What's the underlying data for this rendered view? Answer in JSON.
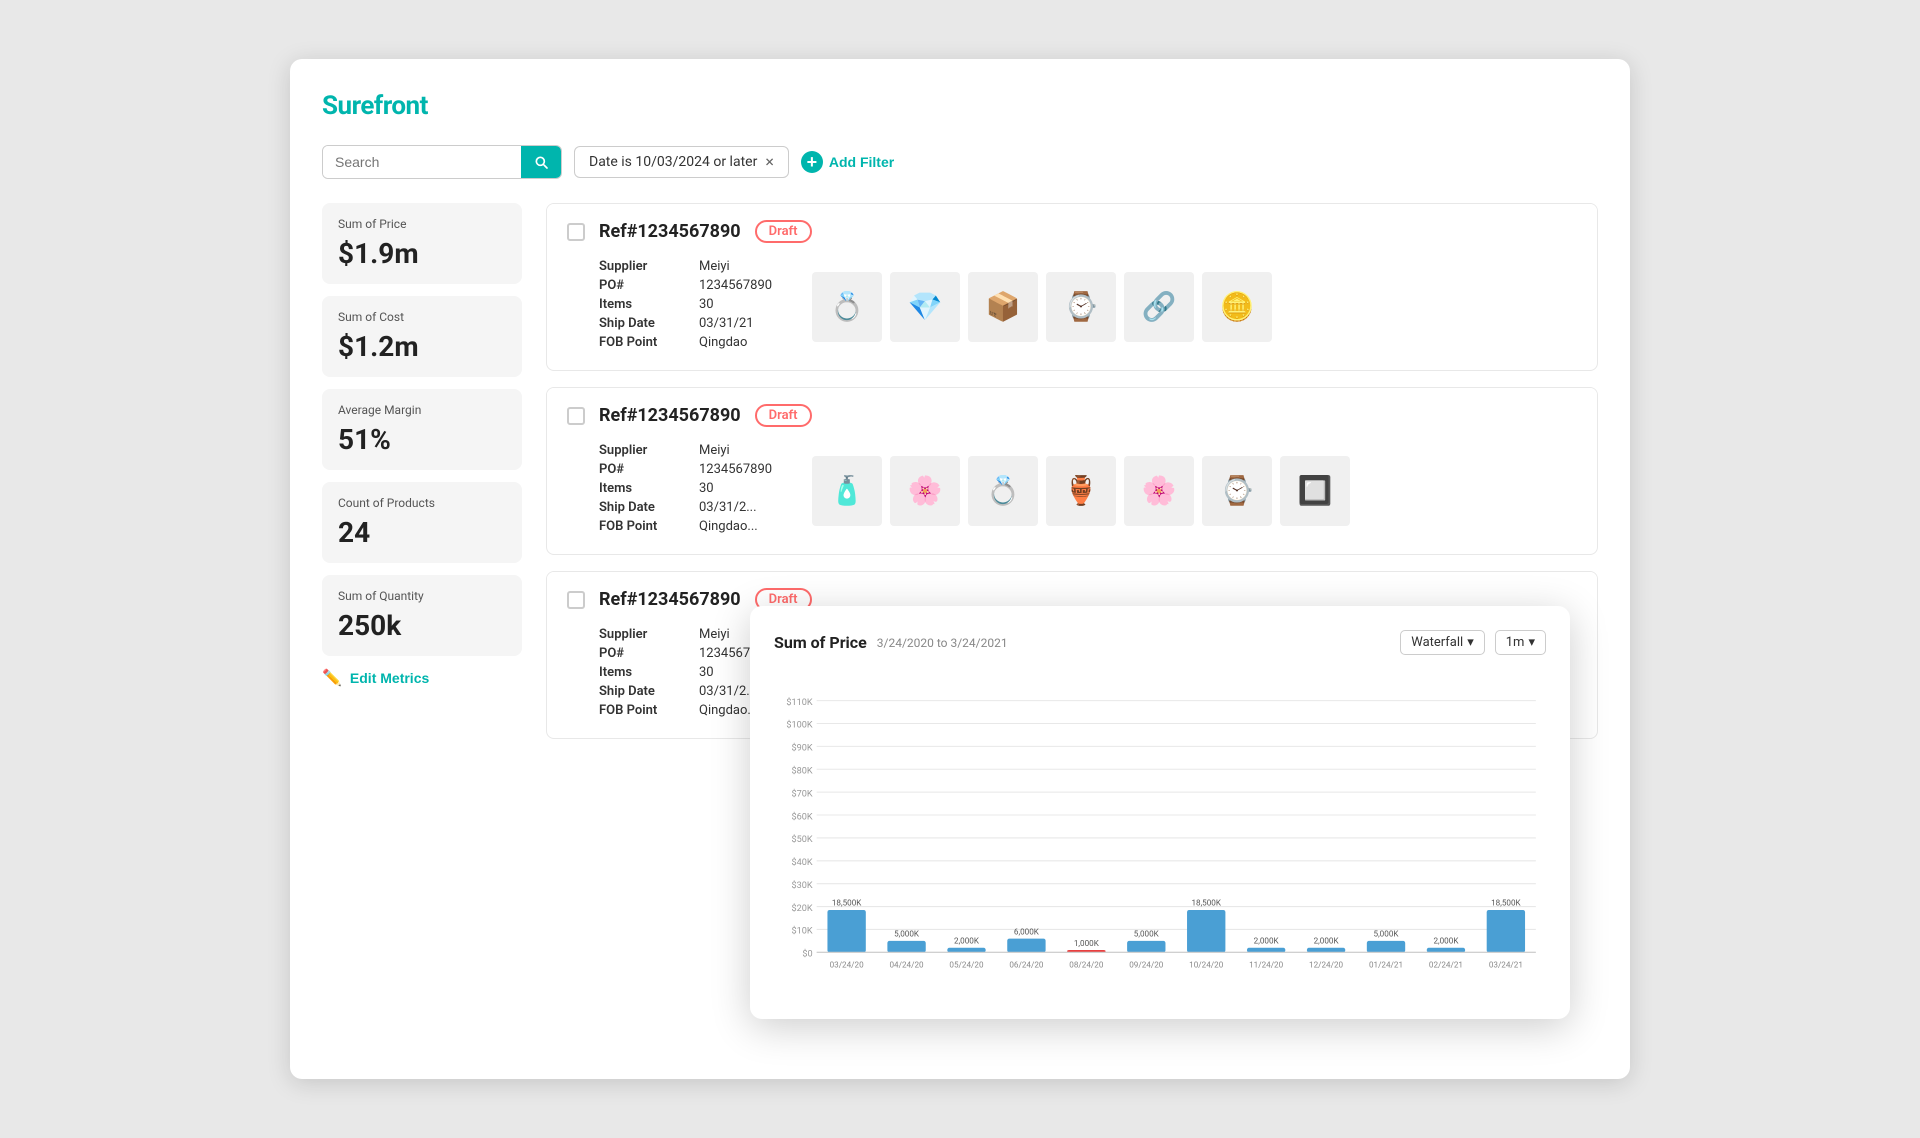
{
  "app": {
    "logo": "Surefront"
  },
  "search": {
    "placeholder": "Search"
  },
  "filter": {
    "label": "Date is 10/03/2024 or later"
  },
  "add_filter": {
    "label": "Add Filter"
  },
  "metrics": [
    {
      "label": "Sum of Price",
      "value": "$1.9m"
    },
    {
      "label": "Sum of Cost",
      "value": "$1.2m"
    },
    {
      "label": "Average Margin",
      "value": "51%"
    },
    {
      "label": "Count of Products",
      "value": "24"
    },
    {
      "label": "Sum of Quantity",
      "value": "250k"
    }
  ],
  "edit_metrics_label": "Edit Metrics",
  "po_cards": [
    {
      "ref": "Ref#1234567890",
      "status": "Draft",
      "supplier_label": "Supplier",
      "supplier": "Meiyi",
      "po_label": "PO#",
      "po": "1234567890",
      "items_label": "Items",
      "items": "30",
      "ship_date_label": "Ship Date",
      "ship_date": "03/31/21",
      "fob_label": "FOB Point",
      "fob": "Qingdao",
      "images": [
        "💍",
        "💎",
        "📦",
        "⌚",
        "🔗",
        "🪙"
      ]
    },
    {
      "ref": "Ref#1234567890",
      "status": "Draft",
      "supplier_label": "Supplier",
      "supplier": "Meiyi",
      "po_label": "PO#",
      "po": "1234567890",
      "items_label": "Items",
      "items": "30",
      "ship_date_label": "Ship Date",
      "ship_date": "03/31/2...",
      "fob_label": "FOB Point",
      "fob": "Qingdao...",
      "images": [
        "🧴",
        "🌸",
        "💍",
        "🏺",
        "🌸",
        "⌚",
        "🔲"
      ]
    },
    {
      "ref": "Ref#1234567890",
      "status": "Draft",
      "supplier_label": "Supplier",
      "supplier": "Meiyi",
      "po_label": "PO#",
      "po": "1234567...",
      "items_label": "Items",
      "items": "30",
      "ship_date_label": "Ship Date",
      "ship_date": "03/31/2...",
      "fob_label": "FOB Point",
      "fob": "Qingdao..."
    }
  ],
  "chart": {
    "title": "Sum of Price",
    "date_range": "3/24/2020 to 3/24/2021",
    "chart_type": "Waterfall",
    "time_period": "1m",
    "x_labels": [
      "03/24/20",
      "04/24/20",
      "05/24/20",
      "06/24/20",
      "08/24/20",
      "09/24/20",
      "10/24/20",
      "11/24/20",
      "12/24/20",
      "01/24/21",
      "02/24/21",
      "03/24/21"
    ],
    "y_labels": [
      "$0",
      "$10K",
      "$20K",
      "$30K",
      "$40K",
      "$50K",
      "$60K",
      "$70K",
      "$80K",
      "$90K",
      "$100K",
      "$110K"
    ],
    "bars": [
      {
        "value": 18500,
        "label": "18,500K",
        "x": 0,
        "color": "#4a9fd4",
        "negative": false
      },
      {
        "value": 5000,
        "label": "5,000K",
        "x": 1,
        "color": "#4a9fd4",
        "negative": false
      },
      {
        "value": 2000,
        "label": "2,000K",
        "x": 2,
        "color": "#4a9fd4",
        "negative": false
      },
      {
        "value": 6000,
        "label": "6,000K",
        "x": 3,
        "color": "#4a9fd4",
        "negative": false
      },
      {
        "value": 1000,
        "label": "1,000K",
        "x": 4,
        "color": "#e84040",
        "negative": true
      },
      {
        "value": 5000,
        "label": "5,000K",
        "x": 5,
        "color": "#4a9fd4",
        "negative": false
      },
      {
        "value": 18500,
        "label": "18,500K",
        "x": 6,
        "color": "#4a9fd4",
        "negative": false
      },
      {
        "value": 2000,
        "label": "2,000K",
        "x": 7,
        "color": "#4a9fd4",
        "negative": false
      },
      {
        "value": 2000,
        "label": "2,000K",
        "x": 8,
        "color": "#4a9fd4",
        "negative": false
      },
      {
        "value": 5000,
        "label": "5,000K",
        "x": 9,
        "color": "#4a9fd4",
        "negative": false
      },
      {
        "value": 2000,
        "label": "2,000K",
        "x": 10,
        "color": "#4a9fd4",
        "negative": false
      },
      {
        "value": 18500,
        "label": "18,500K",
        "x": 11,
        "color": "#4a9fd4",
        "negative": false
      }
    ]
  }
}
